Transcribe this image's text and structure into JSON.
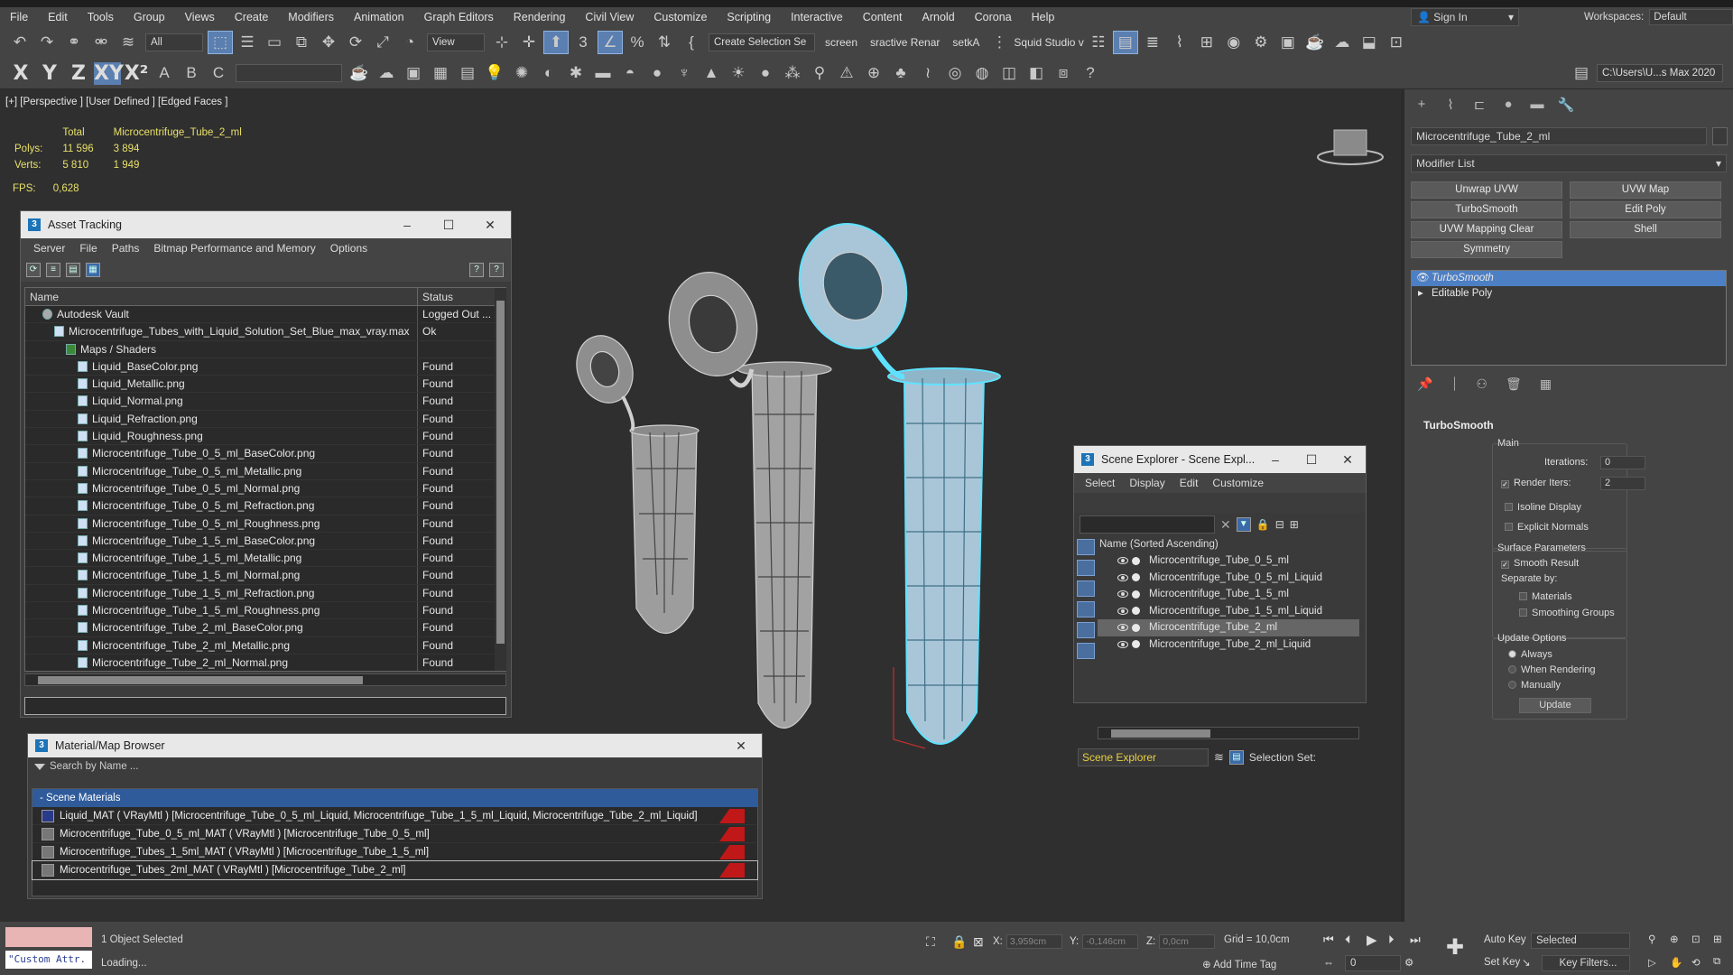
{
  "menu": [
    "File",
    "Edit",
    "Tools",
    "Group",
    "Views",
    "Create",
    "Modifiers",
    "Animation",
    "Graph Editors",
    "Rendering",
    "Civil View",
    "Customize",
    "Scripting",
    "Interactive",
    "Content",
    "Arnold",
    "Corona",
    "Help"
  ],
  "signin": "Sign In",
  "workspaces": {
    "label": "Workspaces:",
    "value": "Default"
  },
  "toolbar": {
    "filter": "All",
    "refcoord": "View",
    "selset": "Create Selection Se",
    "screen": "screen",
    "interactive": "sractive Renar",
    "setka": "setkA",
    "squid": "Squid Studio v",
    "path": "C:\\Users\\U...s Max 2020",
    "axes": [
      "X",
      "Y",
      "Z",
      "XY",
      "X²"
    ]
  },
  "viewport": {
    "label": "[+] [Perspective ] [User Defined ] [Edged Faces ]",
    "stats": {
      "total": "Total",
      "object": "Microcentrifuge_Tube_2_ml",
      "polys_label": "Polys:",
      "polys_total": "11 596",
      "polys_obj": "3 894",
      "verts_label": "Verts:",
      "verts_total": "5 810",
      "verts_obj": "1 949"
    },
    "fps_label": "FPS:",
    "fps": "0,628"
  },
  "asset_tracking": {
    "title": "Asset Tracking",
    "menu": [
      "Server",
      "File",
      "Paths",
      "Bitmap Performance and Memory",
      "Options"
    ],
    "columns": {
      "name": "Name",
      "status": "Status"
    },
    "rows": [
      {
        "name": "Autodesk Vault",
        "status": "Logged Out ...",
        "indent": 1
      },
      {
        "name": "Microcentrifuge_Tubes_with_Liquid_Solution_Set_Blue_max_vray.max",
        "status": "Ok",
        "indent": 2
      },
      {
        "name": "Maps / Shaders",
        "status": "",
        "indent": 3
      },
      {
        "name": "Liquid_BaseColor.png",
        "status": "Found",
        "indent": 4
      },
      {
        "name": "Liquid_Metallic.png",
        "status": "Found",
        "indent": 4
      },
      {
        "name": "Liquid_Normal.png",
        "status": "Found",
        "indent": 4
      },
      {
        "name": "Liquid_Refraction.png",
        "status": "Found",
        "indent": 4
      },
      {
        "name": "Liquid_Roughness.png",
        "status": "Found",
        "indent": 4
      },
      {
        "name": "Microcentrifuge_Tube_0_5_ml_BaseColor.png",
        "status": "Found",
        "indent": 4
      },
      {
        "name": "Microcentrifuge_Tube_0_5_ml_Metallic.png",
        "status": "Found",
        "indent": 4
      },
      {
        "name": "Microcentrifuge_Tube_0_5_ml_Normal.png",
        "status": "Found",
        "indent": 4
      },
      {
        "name": "Microcentrifuge_Tube_0_5_ml_Refraction.png",
        "status": "Found",
        "indent": 4
      },
      {
        "name": "Microcentrifuge_Tube_0_5_ml_Roughness.png",
        "status": "Found",
        "indent": 4
      },
      {
        "name": "Microcentrifuge_Tube_1_5_ml_BaseColor.png",
        "status": "Found",
        "indent": 4
      },
      {
        "name": "Microcentrifuge_Tube_1_5_ml_Metallic.png",
        "status": "Found",
        "indent": 4
      },
      {
        "name": "Microcentrifuge_Tube_1_5_ml_Normal.png",
        "status": "Found",
        "indent": 4
      },
      {
        "name": "Microcentrifuge_Tube_1_5_ml_Refraction.png",
        "status": "Found",
        "indent": 4
      },
      {
        "name": "Microcentrifuge_Tube_1_5_ml_Roughness.png",
        "status": "Found",
        "indent": 4
      },
      {
        "name": "Microcentrifuge_Tube_2_ml_BaseColor.png",
        "status": "Found",
        "indent": 4
      },
      {
        "name": "Microcentrifuge_Tube_2_ml_Metallic.png",
        "status": "Found",
        "indent": 4
      },
      {
        "name": "Microcentrifuge_Tube_2_ml_Normal.png",
        "status": "Found",
        "indent": 4
      }
    ]
  },
  "scene_explorer": {
    "title": "Scene Explorer - Scene Expl...",
    "menu": [
      "Select",
      "Display",
      "Edit",
      "Customize"
    ],
    "header": "Name (Sorted Ascending)",
    "items": [
      "Microcentrifuge_Tube_0_5_ml",
      "Microcentrifuge_Tube_0_5_ml_Liquid",
      "Microcentrifuge_Tube_1_5_ml",
      "Microcentrifuge_Tube_1_5_ml_Liquid",
      "Microcentrifuge_Tube_2_ml",
      "Microcentrifuge_Tube_2_ml_Liquid"
    ],
    "selected_index": 4,
    "footer_explorer": "Scene Explorer",
    "footer_selset": "Selection Set:"
  },
  "material_browser": {
    "title": "Material/Map Browser",
    "search_placeholder": "Search by Name ...",
    "group": "- Scene Materials",
    "materials": [
      "Liquid_MAT ( VRayMtl ) [Microcentrifuge_Tube_0_5_ml_Liquid, Microcentrifuge_Tube_1_5_ml_Liquid, Microcentrifuge_Tube_2_ml_Liquid]",
      "Microcentrifuge_Tube_0_5_ml_MAT ( VRayMtl ) [Microcentrifuge_Tube_0_5_ml]",
      "Microcentrifuge_Tubes_1_5ml_MAT ( VRayMtl ) [Microcentrifuge_Tube_1_5_ml]",
      "Microcentrifuge_Tubes_2ml_MAT ( VRayMtl ) [Microcentrifuge_Tube_2_ml]"
    ]
  },
  "command_panel": {
    "object_name": "Microcentrifuge_Tube_2_ml",
    "modifier_list": "Modifier List",
    "buttons": [
      "Unwrap UVW",
      "UVW Map",
      "TurboSmooth",
      "Edit Poly",
      "UVW Mapping Clear",
      "Shell",
      "Symmetry"
    ],
    "stack": [
      "TurboSmooth",
      "Editable Poly"
    ],
    "rollout": {
      "title": "TurboSmooth",
      "main": "Main",
      "iterations_label": "Iterations:",
      "iterations": "0",
      "render_iters_label": "Render Iters:",
      "render_iters": "2",
      "isoline": "Isoline Display",
      "explicit": "Explicit Normals",
      "surface": "Surface Parameters",
      "smooth_result": "Smooth Result",
      "separate": "Separate by:",
      "materials": "Materials",
      "smoothing": "Smoothing Groups",
      "update_options": "Update Options",
      "always": "Always",
      "when_rendering": "When Rendering",
      "manually": "Manually",
      "update": "Update"
    }
  },
  "status": {
    "custom": "\"Custom Attr.",
    "selected": "1 Object Selected",
    "loading": "Loading...",
    "x_label": "X:",
    "x": "3,959cm",
    "y_label": "Y:",
    "y": "-0,146cm",
    "z_label": "Z:",
    "z": "0,0cm",
    "grid": "Grid = 10,0cm",
    "add_time_tag": "Add Time Tag",
    "auto_key": "Auto Key",
    "set_key": "Set Key",
    "key_mode": "Selected",
    "key_filters": "Key Filters...",
    "frame": "0"
  }
}
